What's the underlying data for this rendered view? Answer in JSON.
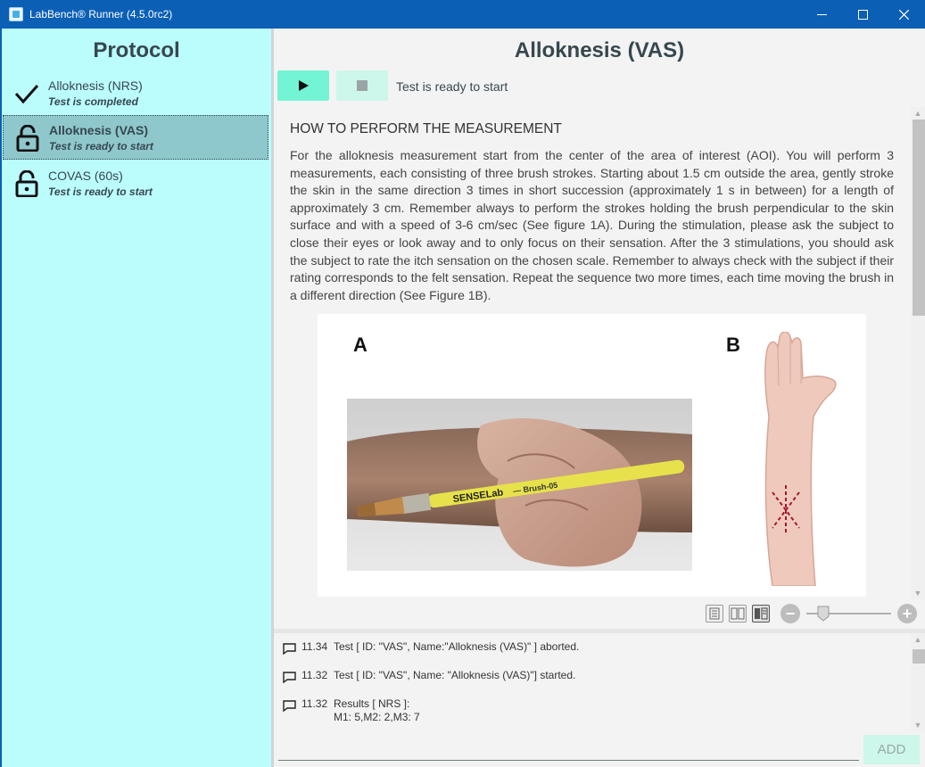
{
  "window": {
    "title": "LabBench® Runner (4.5.0rc2)",
    "accent": "#0b5fb5"
  },
  "sidebar": {
    "heading": "Protocol",
    "items": [
      {
        "name": "Alloknesis (NRS)",
        "status": "Test is completed",
        "icon": "checkmark-icon",
        "selected": false
      },
      {
        "name": "Alloknesis (VAS)",
        "status": "Test is ready to start",
        "icon": "unlocked-padlock-icon",
        "selected": true
      },
      {
        "name": "COVAS (60s)",
        "status": "Test is ready to start",
        "icon": "unlocked-padlock-icon",
        "selected": false
      }
    ],
    "background": "#bbfcfd"
  },
  "main": {
    "title": "Alloknesis (VAS)",
    "run_button_icon": "play-icon",
    "stop_button_icon": "stop-icon",
    "test_status": "Test is ready to start",
    "instructions": {
      "heading": "HOW TO PERFORM THE MEASUREMENT",
      "body": "For the alloknesis measurement start from the center of the area of interest (AOI). You will perform 3 measurements, each consisting of three brush strokes. Starting about 1.5 cm outside the area, gently stroke the skin in the same direction 3 times in short succession (approximately 1 s in between) for a length of approximately 3 cm. Remember always to perform the strokes holding the brush perpendicular to the skin surface and with a speed of 3-6 cm/sec (See figure 1A). During the stimulation, please ask the subject to close their eyes or look away and to only focus on their sensation. After the 3 stimulations, you should ask the subject to rate the itch sensation on the chosen scale. Remember to always check with the subject if their rating corresponds to the felt sensation. Repeat the sequence two more times, each time moving the brush in a different direction (See Figure 1B).",
      "figure": {
        "label_a": "A",
        "label_b": "B",
        "brush_text": "SENSELab",
        "brush_model": "— Brush-05"
      }
    },
    "zoom_minus": "−",
    "zoom_plus": "+",
    "zoom_level": 0.2
  },
  "log": {
    "entries": [
      {
        "time": "11.34",
        "text": "Test [ ID: \"VAS\", Name:\"Alloknesis (VAS)\" ] aborted.",
        "detail": ""
      },
      {
        "time": "11.32",
        "text": "Test [ ID: \"VAS\", Name: \"Alloknesis (VAS)\"] started.",
        "detail": ""
      },
      {
        "time": "11.32",
        "text": "Results [ NRS ]:",
        "detail": "M1: 5,M2: 2,M3: 7"
      }
    ],
    "command_value": "",
    "add_label": "ADD"
  }
}
